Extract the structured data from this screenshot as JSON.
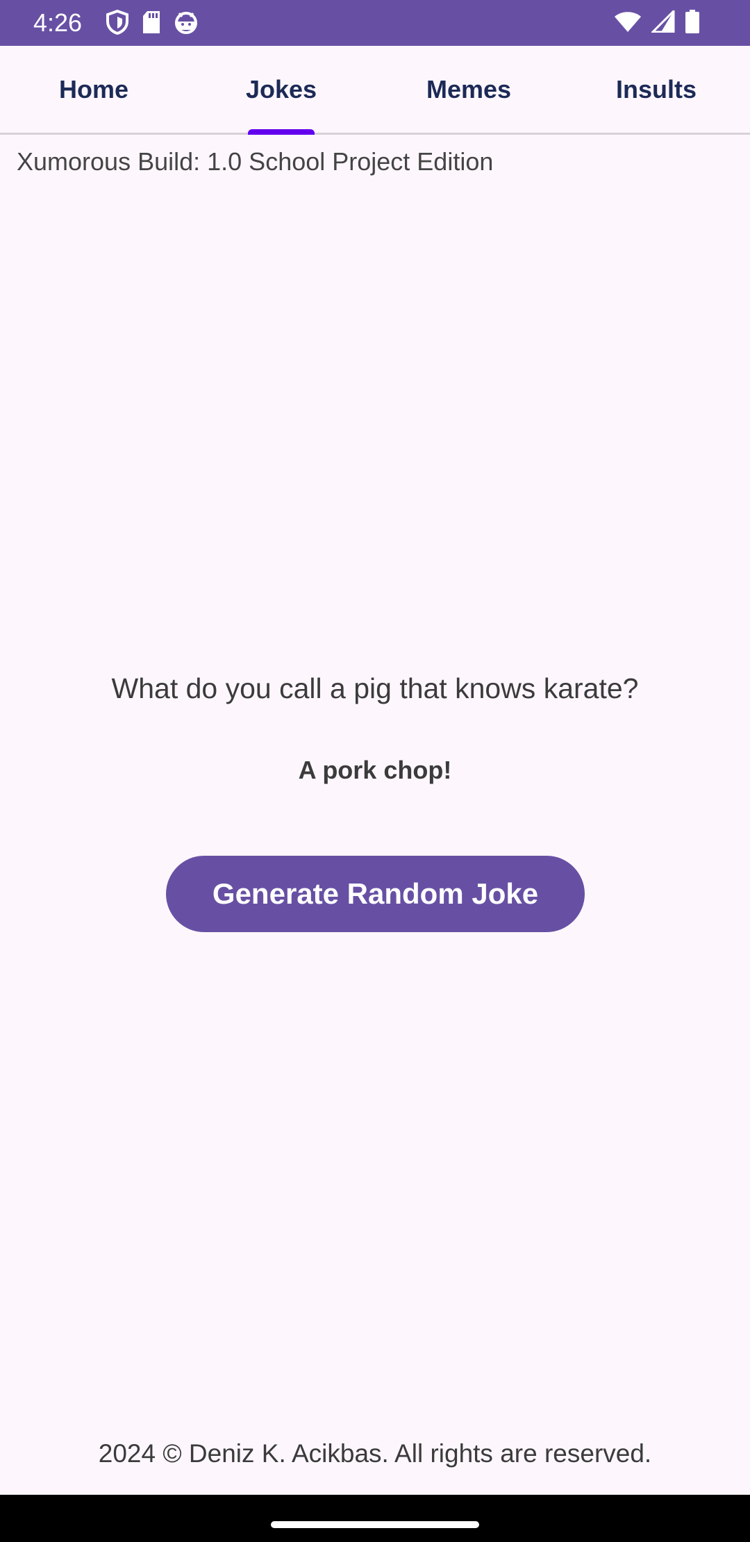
{
  "status_bar": {
    "time": "4:26",
    "background_color": "#6750a4",
    "left_icons": [
      "shield-icon",
      "sd-card-icon",
      "android-face-icon"
    ],
    "right_icons": [
      "wifi-icon",
      "signal-icon",
      "battery-icon"
    ]
  },
  "tabs": [
    {
      "label": "Home",
      "selected": false
    },
    {
      "label": "Jokes",
      "selected": true
    },
    {
      "label": "Memes",
      "selected": false
    },
    {
      "label": "Insults",
      "selected": false
    }
  ],
  "build_label": "Xumorous Build: 1.0 School Project Edition",
  "joke": {
    "question": "What do you call a pig that knows karate?",
    "answer": "A pork chop!"
  },
  "generate_button_label": "Generate Random Joke",
  "footer": "2024 © Deniz K. Acikbas. All rights are reserved.",
  "colors": {
    "accent": "#6750a4",
    "tab_indicator": "#6200ee",
    "tab_text": "#1d2a57",
    "background": "#fdf7fd"
  }
}
